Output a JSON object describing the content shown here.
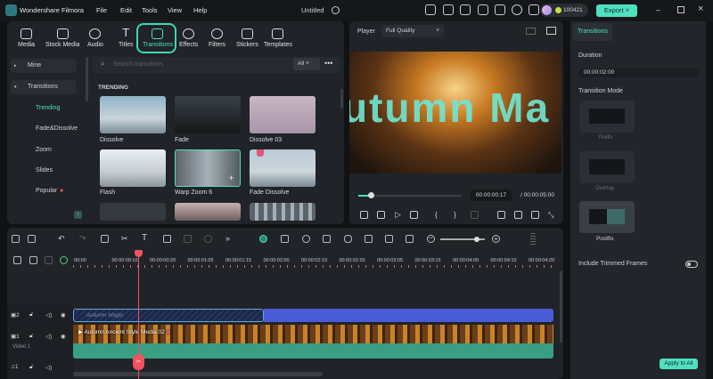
{
  "app": {
    "title": "Wondershare Filmora",
    "project": "Untitled",
    "credits": "100421",
    "export": "Export",
    "menu": [
      "File",
      "Edit",
      "Tools",
      "View",
      "Help"
    ]
  },
  "colors": {
    "accent": "#4fe0c0",
    "playhead": "#f0525e",
    "title_clip": "#4a5bd6",
    "audio_clip": "#3a9e83"
  },
  "toolbar": [
    "Media",
    "Stock Media",
    "Audio",
    "Titles",
    "Transitions",
    "Effects",
    "Filters",
    "Stickers",
    "Templates"
  ],
  "toolbar_active": "Transitions",
  "sidebar": {
    "mine": "Mine",
    "transitions": "Transitions",
    "items": [
      "Trending",
      "Fade&Dissolve",
      "Zoom",
      "Slides",
      "Popular"
    ],
    "active": "Trending"
  },
  "search": {
    "placeholder": "Search transitions",
    "filter": "All"
  },
  "section": "TRENDING",
  "thumbs": [
    "Dissolve",
    "Fade",
    "Dissolve 03",
    "Flash",
    "Warp Zoom 6",
    "Fade Dissolve"
  ],
  "player": {
    "label": "Player",
    "quality": "Full Quality",
    "overlay_text": "utumn Ma",
    "current": "00:00:00:17",
    "total": "/ 00:00:05:00",
    "progress": 0.06
  },
  "ruler": [
    "00:00",
    "00:00:00:10",
    "00:00:00:20",
    "00:00:01:05",
    "00:00:01:15",
    "00:00:02:00",
    "00:00:02:10",
    "00:00:02:20",
    "00:00:03:05",
    "00:00:03:15",
    "00:00:04:00",
    "00:00:04:10",
    "00:00:04:20"
  ],
  "tracks": {
    "t2": "2",
    "t1": "1",
    "video_label": "Video 1",
    "a1": "1",
    "title_clip": "Autumn Magic",
    "video_clip": "Autumn Ancient Style Media 02"
  },
  "right": {
    "tab": "Transitions",
    "duration_label": "Duration",
    "duration": "00:00:02:00",
    "mode_label": "Transition Mode",
    "modes": [
      "Prefix",
      "Overlap",
      "Postfix"
    ],
    "selected_mode": "Postfix",
    "trim_label": "Include Trimmed Frames",
    "trim_on": false,
    "apply": "Apply to All"
  }
}
